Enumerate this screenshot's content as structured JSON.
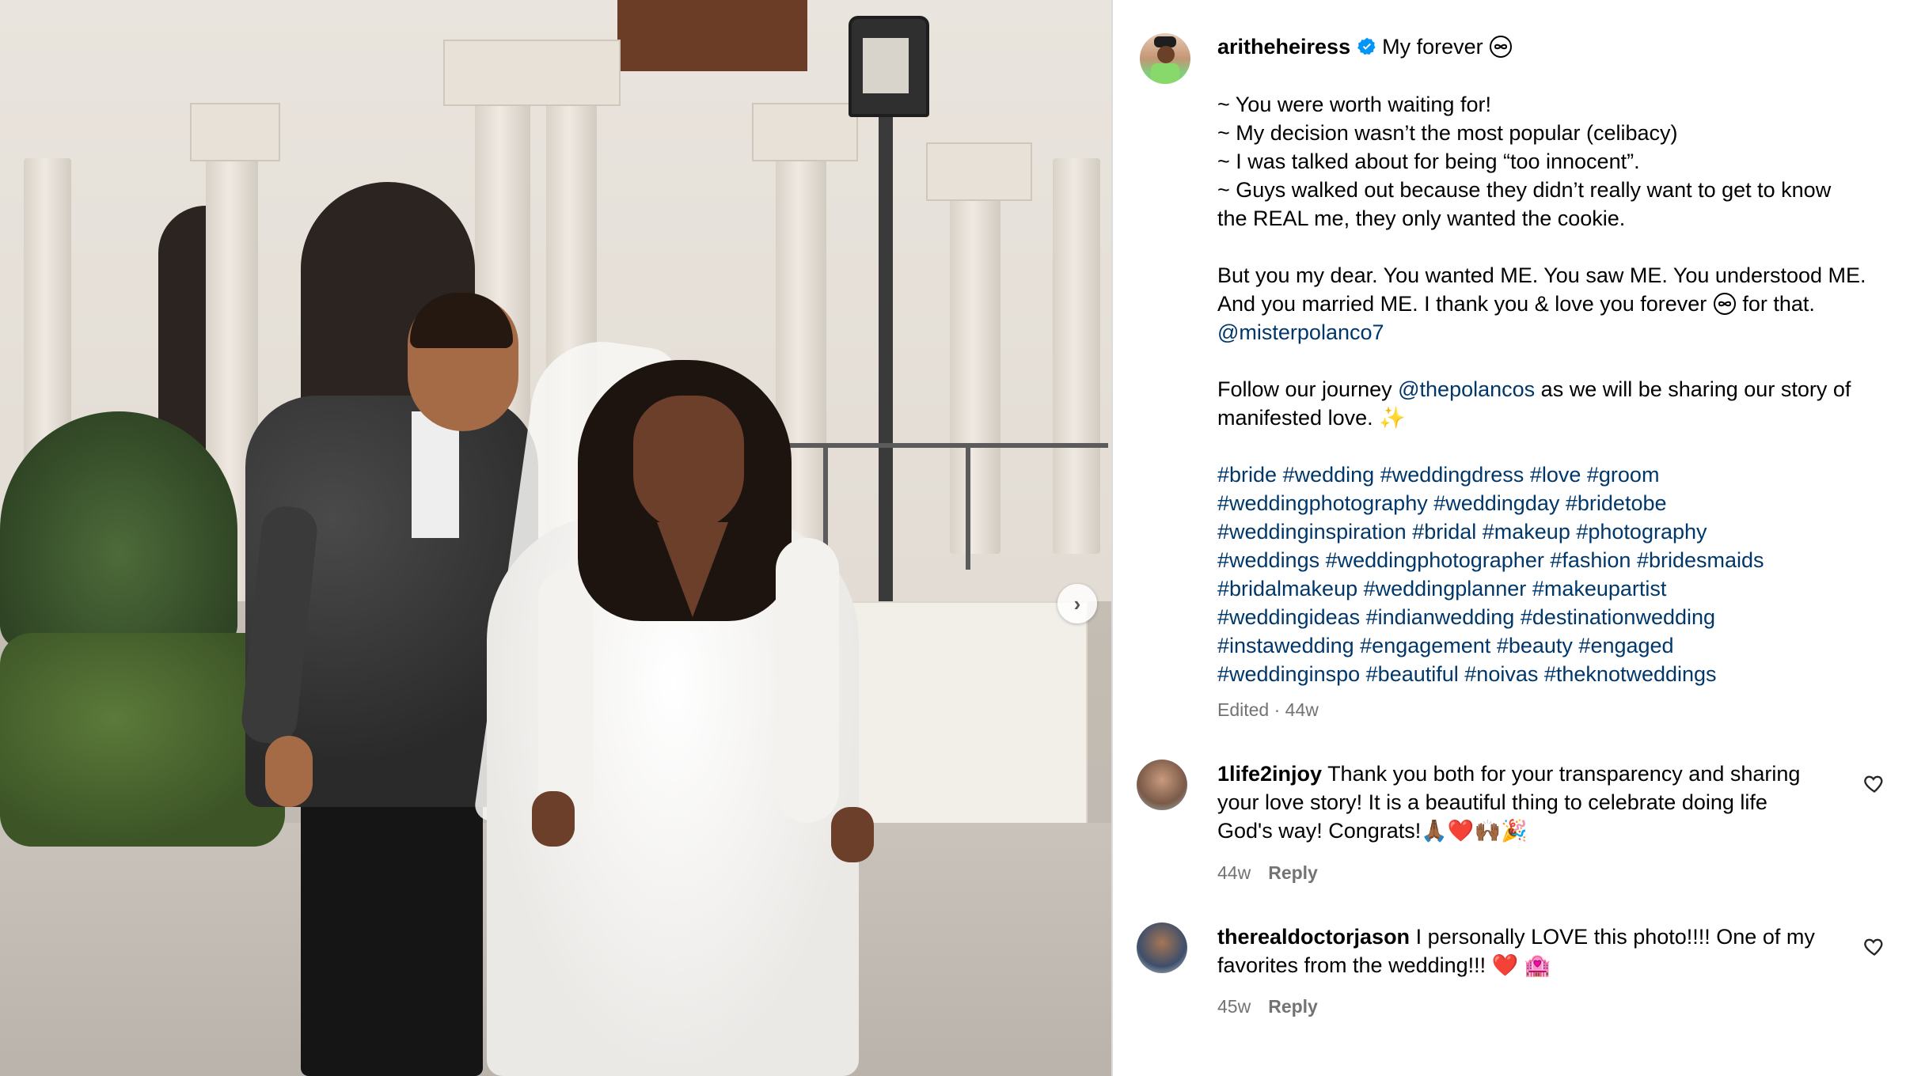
{
  "post": {
    "username": "aritheheiress",
    "title": "My forever",
    "caption_lines": [
      "~ You were worth waiting for!",
      "~ My decision wasn’t the most popular (celibacy)",
      "~ I was talked about for being “too innocent”.",
      "~ Guys walked out because they didn’t really want to get to know the REAL me, they only wanted the cookie."
    ],
    "para2_text": "But you my dear. You wanted ME. You saw ME. You understood ME. And you married ME. I thank you & love you forever",
    "para2_tail": "for that.",
    "mention_1": "@misterpolanco7",
    "para3_prefix": "Follow our journey",
    "mention_2": "@thepolancos",
    "para3_suffix": "as we will be sharing our story of manifested love.",
    "sparkle": "✨",
    "hashtags": [
      "#bride",
      "#wedding",
      "#weddingdress",
      "#love",
      "#groom",
      "#weddingphotography",
      "#weddingday",
      "#bridetobe",
      "#weddinginspiration",
      "#bridal",
      "#makeup",
      "#photography",
      "#weddings",
      "#weddingphotographer",
      "#fashion",
      "#bridesmaids",
      "#bridalmakeup",
      "#weddingplanner",
      "#makeupartist",
      "#weddingideas",
      "#indianwedding",
      "#destinationwedding",
      "#instawedding",
      "#engagement",
      "#beauty",
      "#engaged",
      "#weddinginspo",
      "#beautiful",
      "#noivas",
      "#theknotweddings"
    ],
    "meta": "Edited · 44w"
  },
  "comments": [
    {
      "username": "1life2injoy",
      "text": "Thank you both for your transparency and sharing your love story! It is a beautiful thing to celebrate doing life God's way! Congrats!🙏🏾❤️🙌🏾🎉",
      "age": "44w",
      "reply": "Reply"
    },
    {
      "username": "therealdoctorjason",
      "text": "I personally LOVE this photo!!!! One of my favorites from the wedding!!! ❤️ 🏩",
      "age": "45w",
      "reply": "Reply"
    }
  ],
  "carousel": {
    "next_icon": "›"
  },
  "icons": {
    "verified": "verified-badge-icon",
    "infinity": "infinity-icon",
    "heart": "heart-outline-icon",
    "next": "chevron-right-icon"
  },
  "colors": {
    "link": "#00376b",
    "meta": "#737373",
    "verified": "#0095f6",
    "divider": "#dbdbdb"
  }
}
